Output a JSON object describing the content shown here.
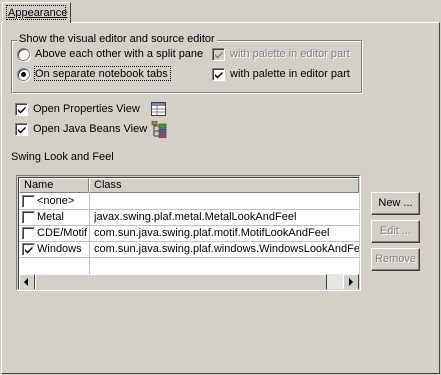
{
  "tabs": [
    {
      "label": "Appearance",
      "selected": true
    }
  ],
  "editor_group": {
    "legend": "Show the visual editor and source editor",
    "radio_split": {
      "label": "Above each other with a split pane",
      "selected": false
    },
    "radio_tabs": {
      "label": "On separate notebook tabs",
      "selected": true
    },
    "palette_split": {
      "label": "with palette in editor part",
      "checked": true,
      "enabled": false
    },
    "palette_tabs": {
      "label": "with palette in editor part",
      "checked": true,
      "enabled": true
    }
  },
  "open_properties": {
    "label": "Open Properties View",
    "checked": true,
    "icon": "properties-view-icon"
  },
  "open_beans": {
    "label": "Open Java Beans View",
    "checked": true,
    "icon": "java-beans-view-icon"
  },
  "laf": {
    "title": "Swing Look and Feel",
    "columns": [
      "Name",
      "Class"
    ],
    "rows": [
      {
        "checked": false,
        "name": "<none>",
        "class": ""
      },
      {
        "checked": false,
        "name": "Metal",
        "class": "javax.swing.plaf.metal.MetalLookAndFeel"
      },
      {
        "checked": false,
        "name": "CDE/Motif",
        "class": "com.sun.java.swing.plaf.motif.MotifLookAndFeel"
      },
      {
        "checked": true,
        "name": "Windows",
        "class": "com.sun.java.swing.plaf.windows.WindowsLookAndFeel"
      }
    ]
  },
  "buttons": {
    "new": {
      "label": "New ...",
      "enabled": true
    },
    "edit": {
      "label": "Edit ...",
      "enabled": false
    },
    "remove": {
      "label": "Remove",
      "enabled": false
    }
  },
  "colors": {
    "face": "#d4d0c8",
    "highlight": "#ffffff",
    "shadow": "#808080",
    "dark_shadow": "#404040",
    "disabled_text": "#808080"
  }
}
